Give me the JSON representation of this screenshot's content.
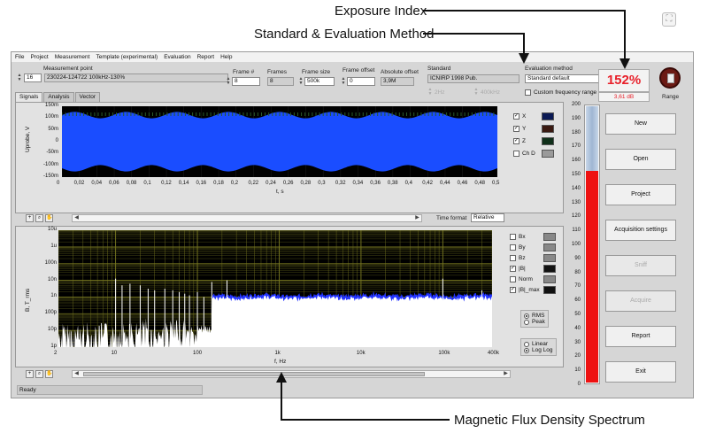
{
  "annotations": {
    "exposure_index": "Exposure Index",
    "standard_method": "Standard & Evaluation Method",
    "flux_spectrum": "Magnetic Flux Density Spectrum"
  },
  "menu": [
    "File",
    "Project",
    "Measurement",
    "Template (experimental)",
    "Evaluation",
    "Report",
    "Help"
  ],
  "header": {
    "measurement_point_label": "Measurement point",
    "measurement_point_index": "16",
    "measurement_point_value": "230224-124722 100kHz-130%",
    "frame_num_label": "Frame #",
    "frame_num_value": "8",
    "frames_label": "Frames",
    "frames_value": "8",
    "frame_size_label": "Frame size",
    "frame_size_value": "500k",
    "frame_offset_label": "Frame offset",
    "frame_offset_value": "0",
    "absolute_offset_label": "Absolute offset",
    "absolute_offset_value": "3,9M",
    "standard_label": "Standard",
    "standard_value": "ICNIRP 1998 Pub.",
    "eval_method_label": "Evaluation method",
    "eval_method_value": "Standard default",
    "freq_min": "2Hz",
    "freq_max": "400kHz",
    "custom_freq_label": "Custom frequency range"
  },
  "tabs": [
    "Signals",
    "Analysis",
    "Vector"
  ],
  "signal_plot": {
    "ylabel": "Uprobe, V",
    "xlabel": "t, s",
    "y_ticks": [
      "150m",
      "100m",
      "50m",
      "0",
      "-50m",
      "-100m",
      "-150m"
    ],
    "x_ticks": [
      "0",
      "0,02",
      "0,04",
      "0,06",
      "0,08",
      "0,1",
      "0,12",
      "0,14",
      "0,16",
      "0,18",
      "0,2",
      "0,22",
      "0,24",
      "0,26",
      "0,28",
      "0,3",
      "0,32",
      "0,34",
      "0,36",
      "0,38",
      "0,4",
      "0,42",
      "0,44",
      "0,46",
      "0,48",
      "0,5"
    ],
    "legend": [
      {
        "label": "X",
        "checked": true,
        "color": "#1a4dff"
      },
      {
        "label": "Y",
        "checked": true,
        "color": "#d84a2a"
      },
      {
        "label": "Z",
        "checked": true,
        "color": "#2fa84a"
      },
      {
        "label": "Ch D",
        "checked": false,
        "color": "#9a9a9a"
      }
    ],
    "time_format_label": "Time format",
    "time_format_value": "Relative"
  },
  "spectrum_plot": {
    "ylabel": "B, T_rms",
    "xlabel": "f, Hz",
    "y_ticks": [
      "10u",
      "1u",
      "100n",
      "10n",
      "1n",
      "100p",
      "10p",
      "1p"
    ],
    "x_ticks": [
      "2",
      "10",
      "100",
      "1k",
      "10k",
      "100k",
      "400k"
    ],
    "legend": [
      {
        "label": "Bx",
        "checked": false
      },
      {
        "label": "By",
        "checked": false
      },
      {
        "label": "Bz",
        "checked": false
      },
      {
        "label": "|B|",
        "checked": true
      },
      {
        "label": "Norm",
        "checked": false
      },
      {
        "label": "|B|_max",
        "checked": true
      }
    ],
    "mode_options": [
      "RMS",
      "Peak"
    ],
    "mode_selected": "RMS",
    "scale_options": [
      "Linear",
      "Log Log"
    ],
    "scale_selected": "Log Log"
  },
  "exposure": {
    "index_value": "152%",
    "db_value": "3,61 dB",
    "range_label": "Range",
    "gauge_ticks": [
      "200",
      "190",
      "180",
      "170",
      "160",
      "150",
      "140",
      "130",
      "120",
      "110",
      "100",
      "90",
      "80",
      "70",
      "60",
      "50",
      "40",
      "30",
      "20",
      "10",
      "0"
    ],
    "gauge_level_percent": 152,
    "gauge_max": 200
  },
  "buttons": [
    {
      "label": "New",
      "enabled": true
    },
    {
      "label": "Open",
      "enabled": true
    },
    {
      "label": "Project",
      "enabled": true
    },
    {
      "label": "Acquisition settings",
      "enabled": true
    },
    {
      "label": "Sniff",
      "enabled": false
    },
    {
      "label": "Acquire",
      "enabled": false
    },
    {
      "label": "Report",
      "enabled": true
    },
    {
      "label": "Exit",
      "enabled": true
    }
  ],
  "status": "Ready"
}
